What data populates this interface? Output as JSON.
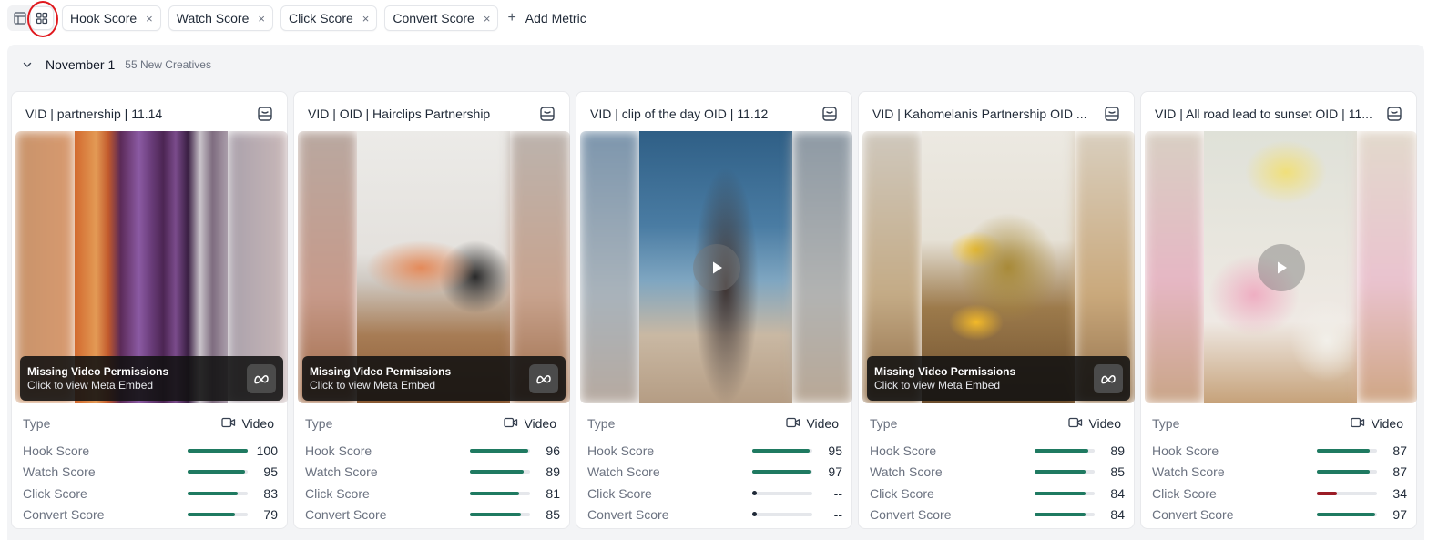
{
  "toolbar": {
    "chips": [
      {
        "label": "Hook Score"
      },
      {
        "label": "Watch Score"
      },
      {
        "label": "Click Score"
      },
      {
        "label": "Convert Score"
      }
    ],
    "add_metric_label": "Add Metric",
    "remove_glyph": "×",
    "add_glyph": "+"
  },
  "group": {
    "title": "November 1",
    "count": "55 New Creatives"
  },
  "permissions": {
    "title": "Missing Video Permissions",
    "subtitle": "Click to view Meta Embed"
  },
  "type_label": "Type",
  "colors": {
    "accent": "#1f7a61",
    "low": "#9b1c26",
    "highlight": "#e0191e"
  },
  "cards": [
    {
      "title": "VID | partnership | 11.14",
      "type": "Video",
      "missing_permissions": true,
      "play": false,
      "metrics": [
        {
          "label": "Hook Score",
          "value": "100",
          "fraction": 1.0,
          "state": "good"
        },
        {
          "label": "Watch Score",
          "value": "95",
          "fraction": 0.95,
          "state": "good"
        },
        {
          "label": "Click Score",
          "value": "83",
          "fraction": 0.83,
          "state": "good"
        },
        {
          "label": "Convert Score",
          "value": "79",
          "fraction": 0.79,
          "state": "good"
        }
      ]
    },
    {
      "title": "VID | OID | Hairclips Partnership",
      "type": "Video",
      "missing_permissions": true,
      "play": false,
      "metrics": [
        {
          "label": "Hook Score",
          "value": "96",
          "fraction": 0.96,
          "state": "good"
        },
        {
          "label": "Watch Score",
          "value": "89",
          "fraction": 0.89,
          "state": "good"
        },
        {
          "label": "Click Score",
          "value": "81",
          "fraction": 0.81,
          "state": "good"
        },
        {
          "label": "Convert Score",
          "value": "85",
          "fraction": 0.85,
          "state": "good"
        }
      ]
    },
    {
      "title": "VID | clip of the day OID | 11.12",
      "type": "Video",
      "missing_permissions": false,
      "play": true,
      "metrics": [
        {
          "label": "Hook Score",
          "value": "95",
          "fraction": 0.95,
          "state": "good"
        },
        {
          "label": "Watch Score",
          "value": "97",
          "fraction": 0.97,
          "state": "good"
        },
        {
          "label": "Click Score",
          "value": "--",
          "fraction": 0,
          "state": "none"
        },
        {
          "label": "Convert Score",
          "value": "--",
          "fraction": 0,
          "state": "none"
        }
      ]
    },
    {
      "title": "VID | Kahomelanis Partnership OID ...",
      "type": "Video",
      "missing_permissions": true,
      "play": false,
      "metrics": [
        {
          "label": "Hook Score",
          "value": "89",
          "fraction": 0.89,
          "state": "good"
        },
        {
          "label": "Watch Score",
          "value": "85",
          "fraction": 0.85,
          "state": "good"
        },
        {
          "label": "Click Score",
          "value": "84",
          "fraction": 0.84,
          "state": "good"
        },
        {
          "label": "Convert Score",
          "value": "84",
          "fraction": 0.84,
          "state": "good"
        }
      ]
    },
    {
      "title": "VID | All road lead to sunset OID | 11...",
      "type": "Video",
      "missing_permissions": false,
      "play": true,
      "metrics": [
        {
          "label": "Hook Score",
          "value": "87",
          "fraction": 0.87,
          "state": "good"
        },
        {
          "label": "Watch Score",
          "value": "87",
          "fraction": 0.87,
          "state": "good"
        },
        {
          "label": "Click Score",
          "value": "34",
          "fraction": 0.34,
          "state": "low"
        },
        {
          "label": "Convert Score",
          "value": "97",
          "fraction": 0.97,
          "state": "good"
        }
      ]
    }
  ]
}
